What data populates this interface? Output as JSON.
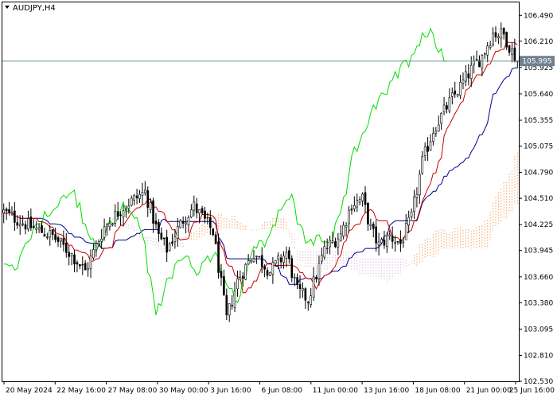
{
  "chart_data": {
    "type": "candlestick",
    "title": "AUDJPY,H4",
    "symbol": "AUDJPY",
    "timeframe": "H4",
    "grid": false,
    "ylim": [
      102.53,
      106.63
    ],
    "y_ticks": [
      "106.490",
      "106.210",
      "105.925",
      "105.640",
      "105.355",
      "105.075",
      "104.790",
      "104.510",
      "104.225",
      "103.945",
      "103.660",
      "103.380",
      "103.095",
      "102.810",
      "102.530"
    ],
    "x_ticks": [
      "20 May 2024",
      "22 May 16:00",
      "27 May 08:00",
      "30 May 00:00",
      "3 Jun 16:00",
      "6 Jun 08:00",
      "11 Jun 00:00",
      "13 Jun 16:00",
      "18 Jun 08:00",
      "21 Jun 00:00",
      "25 Jun 16:00"
    ],
    "current_price": "105.995",
    "bar_count": 190,
    "colors": {
      "candle": "#000000",
      "tenkan_sen": "#cc0000",
      "kijun_sen": "#00008b",
      "chikou_span": "#00dd00",
      "kumo_bullish": "#f4a460",
      "kumo_bearish": "#d8bfd8",
      "price_line": "#6f8f8f",
      "price_label_bg": "#708090",
      "price_label_text": "#ffffff"
    },
    "key_points": [
      [
        0,
        104.36
      ],
      [
        10,
        104.2
      ],
      [
        18,
        104.1
      ],
      [
        25,
        103.9
      ],
      [
        30,
        103.72
      ],
      [
        37,
        104.2
      ],
      [
        44,
        104.42
      ],
      [
        52,
        104.58
      ],
      [
        57,
        104.1
      ],
      [
        60,
        103.96
      ],
      [
        66,
        104.28
      ],
      [
        70,
        104.42
      ],
      [
        77,
        104.15
      ],
      [
        82,
        103.2
      ],
      [
        86,
        103.62
      ],
      [
        92,
        103.92
      ],
      [
        98,
        103.72
      ],
      [
        104,
        103.92
      ],
      [
        108,
        103.5
      ],
      [
        112,
        103.42
      ],
      [
        118,
        103.95
      ],
      [
        124,
        104.12
      ],
      [
        128,
        104.45
      ],
      [
        132,
        104.5
      ],
      [
        135,
        104.18
      ],
      [
        138,
        104.0
      ],
      [
        142,
        104.1
      ],
      [
        146,
        104.02
      ],
      [
        150,
        104.3
      ],
      [
        154,
        104.9
      ],
      [
        158,
        105.25
      ],
      [
        163,
        105.5
      ],
      [
        168,
        105.72
      ],
      [
        172,
        105.9
      ],
      [
        176,
        106.05
      ],
      [
        180,
        106.3
      ],
      [
        184,
        106.28
      ],
      [
        187,
        106.1
      ],
      [
        189,
        105.99
      ]
    ],
    "ohlc_note": "190 H4 candles generated from key_points as a smooth close path with seeded wicks; Ichimoku lines derived from closes."
  }
}
